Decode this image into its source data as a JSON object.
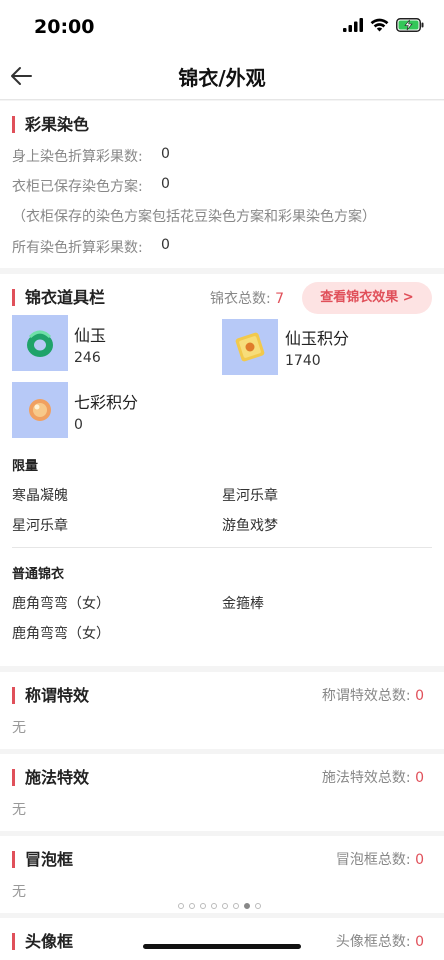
{
  "status": {
    "time": "20:00"
  },
  "nav": {
    "title": "锦衣/外观"
  },
  "dye": {
    "title": "彩果染色",
    "rows": [
      {
        "label": "身上染色折算彩果数:",
        "value": "0"
      },
      {
        "label": "衣柜已保存染色方案:",
        "value": "0"
      },
      {
        "note": "（衣柜保存的染色方案包括花豆染色方案和彩果染色方案）"
      },
      {
        "label": "所有染色折算彩果数:",
        "value": "0"
      }
    ]
  },
  "props": {
    "title": "锦衣道具栏",
    "total_label": "锦衣总数:",
    "total_value": "7",
    "view_button": "查看锦衣效果 >",
    "items": [
      {
        "name": "仙玉",
        "count": "246",
        "icon": "jade-icon"
      },
      {
        "name": "仙玉积分",
        "count": "1740",
        "icon": "jade-points-icon"
      },
      {
        "name": "七彩积分",
        "count": "0",
        "icon": "rainbow-points-icon"
      }
    ],
    "limited_title": "限量",
    "limited": [
      "寒晶凝魄",
      "星河乐章",
      "星河乐章",
      "游鱼戏梦"
    ],
    "normal_title": "普通锦衣",
    "normal": [
      "鹿角弯弯（女）",
      "金箍棒",
      "鹿角弯弯（女）"
    ]
  },
  "title_effect": {
    "title": "称谓特效",
    "count_label": "称谓特效总数:",
    "count": "0",
    "empty": "无"
  },
  "cast_effect": {
    "title": "施法特效",
    "count_label": "施法特效总数:",
    "count": "0",
    "empty": "无"
  },
  "bubble": {
    "title": "冒泡框",
    "count_label": "冒泡框总数:",
    "count": "0",
    "empty": "无"
  },
  "avatar": {
    "title": "头像框",
    "count_label": "头像框总数:",
    "count": "0"
  },
  "pager": {
    "total": 8,
    "active": 7
  },
  "colors": {
    "accent": "#e0505a",
    "item_bg": "#b7c9f7"
  }
}
